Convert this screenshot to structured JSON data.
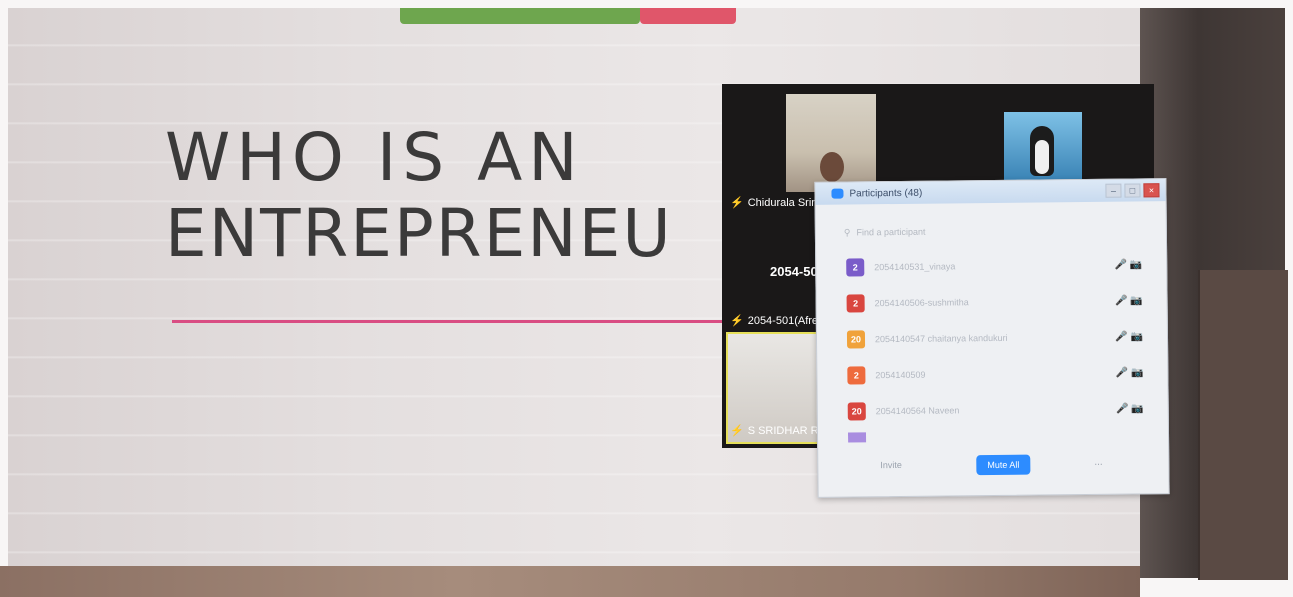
{
  "slide": {
    "title_line1": "WHO IS AN",
    "title_line2": "ENTREPRENEU"
  },
  "gallery": {
    "tiles": [
      {
        "name": "Chidurala Srini"
      },
      {
        "name": "2054-501"
      },
      {
        "name": "2054-501(Afre"
      },
      {
        "name": "S SRIDHAR RE"
      }
    ],
    "mic_muted_glyph": "⚡"
  },
  "participants": {
    "title": "Participants (48)",
    "search_placeholder": "Find a participant",
    "list": [
      {
        "initial": "2",
        "name": "2054140531_vinaya",
        "color": "#7a5cc9"
      },
      {
        "initial": "2",
        "name": "2054140506-sushmitha",
        "color": "#d9463f"
      },
      {
        "initial": "20",
        "name": "2054140547 chaitanya kandukuri",
        "color": "#f0a23a"
      },
      {
        "initial": "2",
        "name": "2054140509",
        "color": "#ee6b3d"
      },
      {
        "initial": "20",
        "name": "2054140564 Naveen",
        "color": "#d9463f"
      },
      {
        "initial": "",
        "name": "",
        "color": "#a98de0"
      }
    ],
    "row_icons": "🎤 📷",
    "footer": {
      "invite_label": "Invite",
      "mute_all_label": "Mute All",
      "more_label": "..."
    }
  }
}
